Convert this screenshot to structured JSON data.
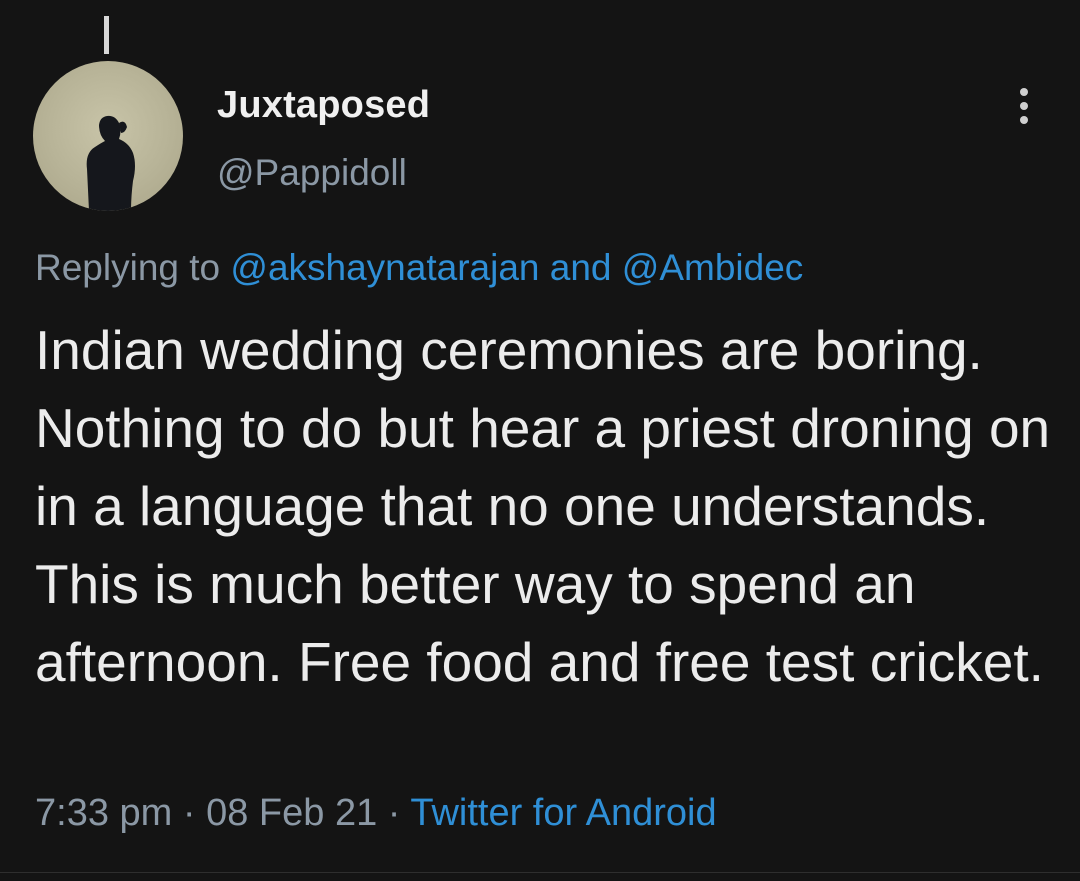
{
  "tweet": {
    "display_name": "Juxtaposed",
    "handle": "@Pappidoll",
    "replying_prefix": "Replying to",
    "reply_mention_1": "@akshaynatarajan",
    "reply_conjunction": "and",
    "reply_mention_2": "@Ambidec",
    "text": "Indian wedding ceremonies are boring. Nothing to do but hear a priest droning on in a language that no one understands. This is much better way to spend an afternoon. Free food and free test cricket.",
    "time": "7:33 pm",
    "separator": "·",
    "date": "08 Feb 21",
    "source": "Twitter for Android"
  },
  "icons": {
    "more": "more-vertical-icon"
  },
  "colors": {
    "background": "#141414",
    "link": "#2f8fd6",
    "muted": "#8b98a5",
    "text": "#ececec"
  }
}
